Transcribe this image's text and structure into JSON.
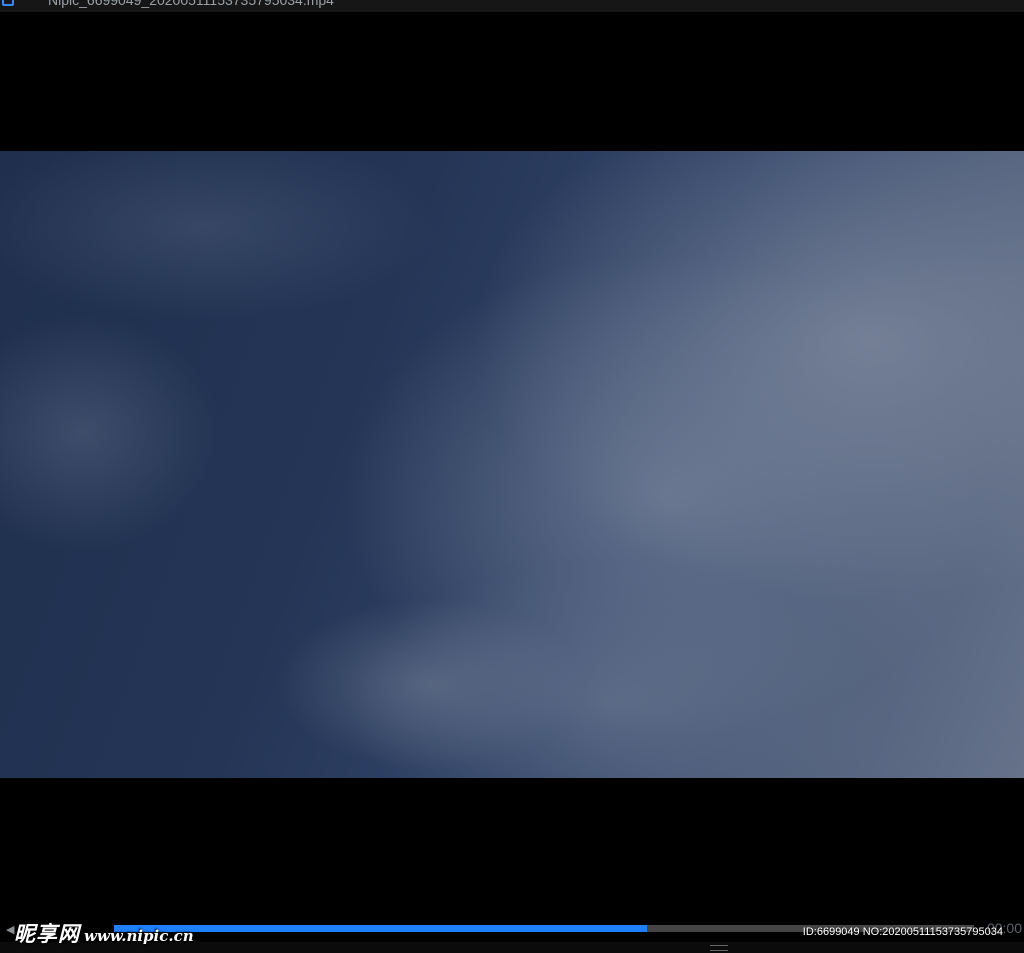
{
  "window": {
    "title": "Nipic_6699049_20200511153735795034.mp4"
  },
  "player": {
    "progress_fraction": 0.62,
    "time_display": "00:00",
    "accent_color": "#1e80ff",
    "prev_icon": "triangle-left-icon"
  },
  "watermark": {
    "logo_cn": "昵享网",
    "logo_url": "www.nipic.cn",
    "id_text": "ID:6699049 NO:20200511153735795034"
  }
}
